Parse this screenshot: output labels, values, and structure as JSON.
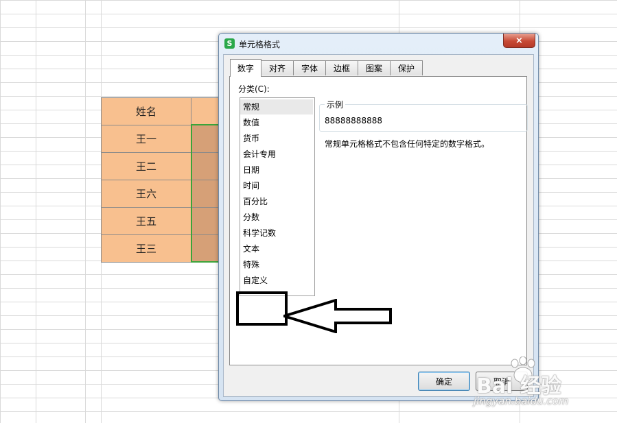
{
  "sheet": {
    "header": "姓名",
    "names": [
      "王一",
      "王二",
      "王六",
      "王五",
      "王三"
    ]
  },
  "dialog": {
    "title": "单元格格式",
    "app_icon": "S",
    "close": "×",
    "tabs": [
      "数字",
      "对齐",
      "字体",
      "边框",
      "图案",
      "保护"
    ],
    "active_tab": "数字",
    "category_label": "分类(C):",
    "categories": [
      "常规",
      "数值",
      "货币",
      "会计专用",
      "日期",
      "时间",
      "百分比",
      "分数",
      "科学记数",
      "文本",
      "特殊",
      "自定义"
    ],
    "selected_category": "常规",
    "sample_label": "示例",
    "sample_value": "88888888888",
    "description": "常规单元格格式不包含任何特定的数字格式。",
    "ok_label": "确定",
    "cancel_label": "取消"
  },
  "watermark": {
    "main": "Bai 经验",
    "sub": "jingyan.baidu.com"
  },
  "colors": {
    "table_fill": "#f8c08f",
    "selection_border": "#3aa43a",
    "app_icon": "#2aa84a",
    "close_button": "#c74a36"
  },
  "icons": {
    "app": "wps-spreadsheet-icon",
    "close": "close-icon",
    "annotation": "arrow-left-icon"
  }
}
